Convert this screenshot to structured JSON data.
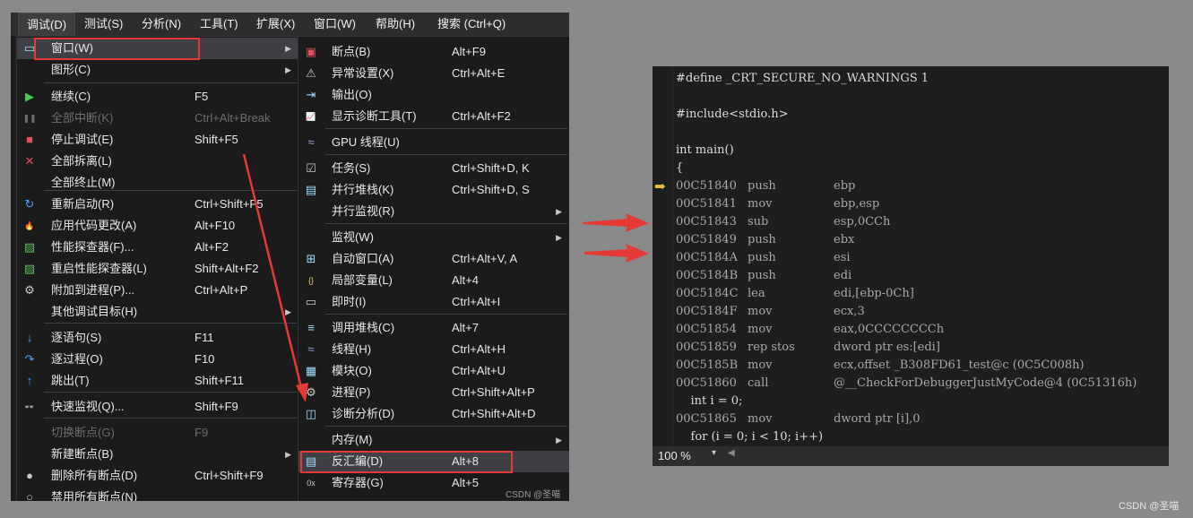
{
  "menubar": {
    "items": [
      "调试(D)",
      "测试(S)",
      "分析(N)",
      "工具(T)",
      "扩展(X)",
      "窗口(W)",
      "帮助(H)",
      "搜索 (Ctrl+Q)"
    ]
  },
  "debug_menu": {
    "items": [
      {
        "icon": "window-icon",
        "label": "窗口(W)",
        "shortcut": "",
        "submenu": true
      },
      {
        "icon": "graphics-icon",
        "label": "图形(C)",
        "shortcut": "",
        "submenu": true
      },
      {
        "icon": "continue-icon",
        "label": "继续(C)",
        "shortcut": "F5"
      },
      {
        "icon": "pause-icon",
        "label": "全部中断(K)",
        "shortcut": "Ctrl+Alt+Break",
        "disabled": true
      },
      {
        "icon": "stop-icon",
        "label": "停止调试(E)",
        "shortcut": "Shift+F5"
      },
      {
        "icon": "detach-icon",
        "label": "全部拆离(L)",
        "shortcut": ""
      },
      {
        "icon": "",
        "label": "全部终止(M)",
        "shortcut": ""
      },
      {
        "icon": "restart-icon",
        "label": "重新启动(R)",
        "shortcut": "Ctrl+Shift+F5"
      },
      {
        "icon": "hot-reload-icon",
        "label": "应用代码更改(A)",
        "shortcut": "Alt+F10"
      },
      {
        "icon": "profiler-icon",
        "label": "性能探查器(F)...",
        "shortcut": "Alt+F2"
      },
      {
        "icon": "profiler-restart-icon",
        "label": "重启性能探查器(L)",
        "shortcut": "Shift+Alt+F2"
      },
      {
        "icon": "attach-icon",
        "label": "附加到进程(P)...",
        "shortcut": "Ctrl+Alt+P"
      },
      {
        "icon": "",
        "label": "其他调试目标(H)",
        "shortcut": "",
        "submenu": true
      },
      {
        "icon": "step-into-icon",
        "label": "逐语句(S)",
        "shortcut": "F11"
      },
      {
        "icon": "step-over-icon",
        "label": "逐过程(O)",
        "shortcut": "F10"
      },
      {
        "icon": "step-out-icon",
        "label": "跳出(T)",
        "shortcut": "Shift+F11"
      },
      {
        "icon": "quickwatch-icon",
        "label": "快速监视(Q)...",
        "shortcut": "Shift+F9"
      },
      {
        "icon": "",
        "label": "切换断点(G)",
        "shortcut": "F9",
        "disabled": true
      },
      {
        "icon": "",
        "label": "新建断点(B)",
        "shortcut": "",
        "submenu": true
      },
      {
        "icon": "delete-breakpoints-icon",
        "label": "删除所有断点(D)",
        "shortcut": "Ctrl+Shift+F9"
      },
      {
        "icon": "disable-breakpoints-icon",
        "label": "禁用所有断点(N)",
        "shortcut": ""
      }
    ]
  },
  "window_menu": {
    "items": [
      {
        "icon": "breakpoints-icon",
        "label": "断点(B)",
        "shortcut": "Alt+F9"
      },
      {
        "icon": "exception-settings-icon",
        "label": "异常设置(X)",
        "shortcut": "Ctrl+Alt+E"
      },
      {
        "icon": "output-icon",
        "label": "输出(O)",
        "shortcut": ""
      },
      {
        "icon": "diagnostic-tools-icon",
        "label": "显示诊断工具(T)",
        "shortcut": "Ctrl+Alt+F2"
      },
      {
        "icon": "gpu-threads-icon",
        "label": "GPU 线程(U)",
        "shortcut": ""
      },
      {
        "icon": "tasks-icon",
        "label": "任务(S)",
        "shortcut": "Ctrl+Shift+D, K"
      },
      {
        "icon": "parallel-stacks-icon",
        "label": "并行堆栈(K)",
        "shortcut": "Ctrl+Shift+D, S"
      },
      {
        "icon": "",
        "label": "并行监视(R)",
        "shortcut": "",
        "submenu": true
      },
      {
        "icon": "",
        "label": "监视(W)",
        "shortcut": "",
        "submenu": true
      },
      {
        "icon": "autos-icon",
        "label": "自动窗口(A)",
        "shortcut": "Ctrl+Alt+V, A"
      },
      {
        "icon": "locals-icon",
        "label": "局部变量(L)",
        "shortcut": "Alt+4"
      },
      {
        "icon": "immediate-icon",
        "label": "即时(I)",
        "shortcut": "Ctrl+Alt+I"
      },
      {
        "icon": "call-stack-icon",
        "label": "调用堆栈(C)",
        "shortcut": "Alt+7"
      },
      {
        "icon": "threads-icon",
        "label": "线程(H)",
        "shortcut": "Ctrl+Alt+H"
      },
      {
        "icon": "modules-icon",
        "label": "模块(O)",
        "shortcut": "Ctrl+Alt+U"
      },
      {
        "icon": "processes-icon",
        "label": "进程(P)",
        "shortcut": "Ctrl+Shift+Alt+P"
      },
      {
        "icon": "diagnostics-icon",
        "label": "诊断分析(D)",
        "shortcut": "Ctrl+Shift+Alt+D"
      },
      {
        "icon": "",
        "label": "内存(M)",
        "shortcut": "",
        "submenu": true
      },
      {
        "icon": "disassembly-icon",
        "label": "反汇编(D)",
        "shortcut": "Alt+8"
      },
      {
        "icon": "registers-icon",
        "label": "寄存器(G)",
        "shortcut": "Alt+5"
      }
    ]
  },
  "watermark_left": "CSDN @圣喵",
  "watermark_right": "CSDN @圣喵",
  "code": {
    "lines": [
      {
        "kind": "src",
        "text": "#define _CRT_SECURE_NO_WARNINGS 1"
      },
      {
        "kind": "blank",
        "text": ""
      },
      {
        "kind": "src",
        "text": "#include<stdio.h>"
      },
      {
        "kind": "blank",
        "text": ""
      },
      {
        "kind": "src",
        "text": "int main()"
      },
      {
        "kind": "src",
        "text": "{"
      },
      {
        "kind": "asm",
        "addr": "00C51840",
        "mnem": "push",
        "ops": "ebp",
        "current": true
      },
      {
        "kind": "asm",
        "addr": "00C51841",
        "mnem": "mov",
        "ops": "ebp,esp"
      },
      {
        "kind": "asm",
        "addr": "00C51843",
        "mnem": "sub",
        "ops": "esp,0CCh"
      },
      {
        "kind": "asm",
        "addr": "00C51849",
        "mnem": "push",
        "ops": "ebx"
      },
      {
        "kind": "asm",
        "addr": "00C5184A",
        "mnem": "push",
        "ops": "esi"
      },
      {
        "kind": "asm",
        "addr": "00C5184B",
        "mnem": "push",
        "ops": "edi"
      },
      {
        "kind": "asm",
        "addr": "00C5184C",
        "mnem": "lea",
        "ops": "edi,[ebp-0Ch]"
      },
      {
        "kind": "asm",
        "addr": "00C5184F",
        "mnem": "mov",
        "ops": "ecx,3"
      },
      {
        "kind": "asm",
        "addr": "00C51854",
        "mnem": "mov",
        "ops": "eax,0CCCCCCCCh"
      },
      {
        "kind": "asm",
        "addr": "00C51859",
        "mnem": "rep stos",
        "ops": "dword ptr es:[edi]"
      },
      {
        "kind": "asm",
        "addr": "00C5185B",
        "mnem": "mov",
        "ops": "ecx,offset _B308FD61_test@c (0C5C008h)"
      },
      {
        "kind": "asm",
        "addr": "00C51860",
        "mnem": "call",
        "ops": "@__CheckForDebuggerJustMyCode@4 (0C51316h)"
      },
      {
        "kind": "src",
        "text": "    int i = 0;"
      },
      {
        "kind": "asm",
        "addr": "00C51865",
        "mnem": "mov",
        "ops": "dword ptr [i],0"
      },
      {
        "kind": "src",
        "text": "    for (i = 0; i < 10; i++)"
      }
    ]
  },
  "status": {
    "zoom": "100 %"
  },
  "colors": {
    "highlight_box": "#e53935",
    "arrow": "#e53935",
    "current_line_arrow": "#e8b93a"
  }
}
